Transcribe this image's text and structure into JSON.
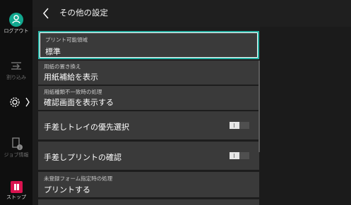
{
  "header": {
    "title": "その他の設定"
  },
  "rail": {
    "logout_label": "ログアウト",
    "interrupt_label": "割り込み",
    "job_status_label": "ジョブ情報",
    "stop_label": "ストップ"
  },
  "settings": {
    "print_area": {
      "label": "プリント可能領域",
      "value": "標準"
    },
    "paper_substitute": {
      "label": "用紙の置き換え",
      "value": "用紙補給を表示"
    },
    "paper_mismatch": {
      "label": "用紙種類不一致時の処理",
      "value": "確認画面を表示する"
    },
    "bypass_priority": {
      "label": "手差しトレイの優先選択",
      "state": "off"
    },
    "bypass_confirm": {
      "label": "手差しプリントの確認",
      "state": "off"
    },
    "unregistered_form": {
      "label": "未登録フォーム指定時の処理",
      "value": "プリントする"
    }
  },
  "colors": {
    "accent": "#2bb3a6",
    "logout": "#12a88f",
    "stop": "#d9134f",
    "row_bg": "#3a3a3a"
  }
}
